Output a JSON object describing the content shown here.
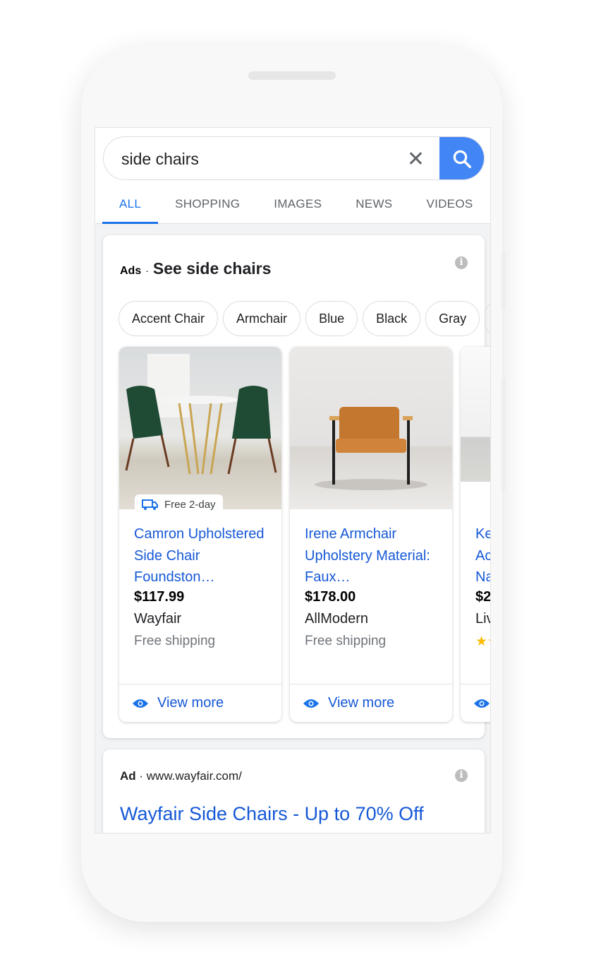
{
  "search": {
    "query": "side chairs",
    "clear_icon": "close-icon",
    "search_icon": "search-icon",
    "accent": "#4285f4"
  },
  "tabs": [
    {
      "label": "ALL",
      "active": true
    },
    {
      "label": "SHOPPING"
    },
    {
      "label": "IMAGES"
    },
    {
      "label": "NEWS"
    },
    {
      "label": "VIDEOS"
    }
  ],
  "ads": {
    "label": "Ads",
    "title": "See side chairs",
    "chips": [
      "Accent Chair",
      "Armchair",
      "Blue",
      "Black",
      "Gray"
    ],
    "products": [
      {
        "title": "Camron Upholstered Side Chair Foundston…",
        "price": "$117.99",
        "merchant": "Wayfair",
        "shipping": "Free shipping",
        "badge": "Free 2-day",
        "view_more": "View more"
      },
      {
        "title": "Irene Armchair Upholstery Material: Faux…",
        "price": "$178.00",
        "merchant": "AllModern",
        "shipping": "Free shipping",
        "view_more": "View more"
      },
      {
        "title": "Ke Ac Na",
        "price": "$2",
        "merchant": "Liv",
        "rating_icon": "star-icon"
      }
    ]
  },
  "ad": {
    "label": "Ad",
    "url": "www.wayfair.com/",
    "headline": "Wayfair Side Chairs - Up to 70% Off"
  },
  "link_color": "#1558d6"
}
